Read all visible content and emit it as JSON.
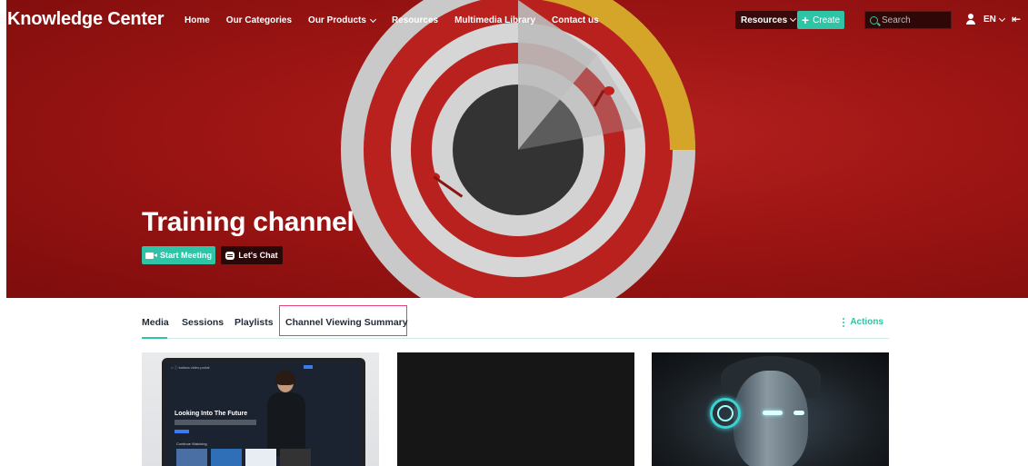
{
  "header": {
    "brand": "Knowledge Center",
    "nav": [
      {
        "label": "Home"
      },
      {
        "label": "Our Categories"
      },
      {
        "label": "Our Products",
        "dropdown": true
      },
      {
        "label": "Resources"
      },
      {
        "label": "Multimedia Library"
      },
      {
        "label": "Contact us"
      }
    ],
    "resources_button": "Resources",
    "create_button": "Create",
    "search_placeholder": "Search",
    "language": "EN"
  },
  "hero": {
    "title": "Training channel",
    "start_meeting": "Start Meeting",
    "lets_chat": "Let's Chat"
  },
  "tabs": {
    "items": [
      "Media",
      "Sessions",
      "Playlists",
      "Channel Viewing Summary"
    ],
    "active": "Media",
    "highlighted": "Channel Viewing Summary",
    "actions_label": "Actions"
  },
  "media": {
    "card1": {
      "headline": "Looking Into The Future",
      "section": "Continue Watching"
    }
  },
  "colors": {
    "accent": "#2ec4a5",
    "hero_red": "#a3181a",
    "highlight_border": "#e0447e",
    "text_dark": "#1d2b3a"
  },
  "icons": [
    "video-camera-icon",
    "chat-icon",
    "plus-icon",
    "search-icon",
    "user-icon",
    "exit-icon",
    "kebab-icon",
    "chevron-down-icon"
  ]
}
